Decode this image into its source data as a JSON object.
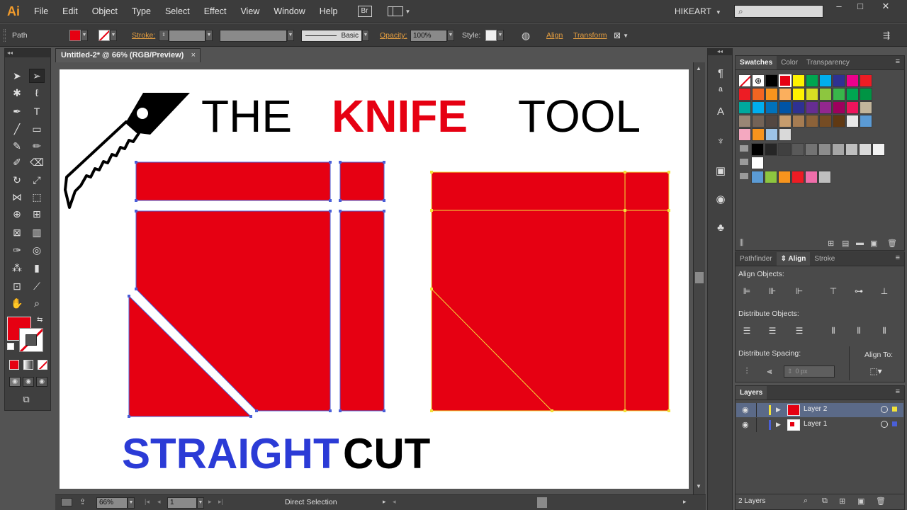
{
  "app": {
    "logo": "Ai",
    "menu": [
      "File",
      "Edit",
      "Object",
      "Type",
      "Select",
      "Effect",
      "View",
      "Window",
      "Help"
    ],
    "bridge_label": "Br",
    "workspace": "HIKEART",
    "window_controls": [
      "–",
      "□",
      "✕"
    ]
  },
  "control_bar": {
    "selection_type": "Path",
    "stroke_label": "Stroke:",
    "brush_label": "Basic",
    "opacity_label": "Opacity:",
    "opacity_value": "100%",
    "style_label": "Style:",
    "align_label": "Align",
    "transform_label": "Transform"
  },
  "document": {
    "tab_title": "Untitled-2* @ 66% (RGB/Preview)",
    "close": "×"
  },
  "artwork": {
    "title_words": [
      "THE",
      "KNIFE",
      "TOOL"
    ],
    "subtitle_words": [
      "STRAIGHT",
      "CUT"
    ],
    "colors": {
      "red": "#e60012",
      "blue": "#2b3bd6",
      "black": "#000000",
      "path_blue": "#4a5fd8",
      "path_yellow": "#f2e23a"
    }
  },
  "status_bar": {
    "zoom": "66%",
    "artboard_number": "1",
    "current_tool": "Direct Selection"
  },
  "swatches_panel": {
    "tabs": [
      "Swatches",
      "Color",
      "Transparency"
    ],
    "rows": [
      [
        "#ffffff",
        "#ffffff",
        "#000000",
        "#e60012",
        "#fff200",
        "#00a650",
        "#00aeef",
        "#2e3192",
        "#ec008c",
        "#ed1c24"
      ],
      [
        "#ed1c24",
        "#f26522",
        "#f7941d",
        "#fbaf5d",
        "#fff200",
        "#d7df23",
        "#8dc63f",
        "#39b54a",
        "#00a651",
        "#009444"
      ],
      [
        "#00a99d",
        "#00aeef",
        "#0072bc",
        "#0054a6",
        "#2e3192",
        "#662d91",
        "#92278f",
        "#9e005d",
        "#ed145b",
        "#c2b59b"
      ],
      [
        "#998675",
        "#736357",
        "#534741",
        "#c69c6d",
        "#a67c52",
        "#8c6239",
        "#754c24",
        "#603913",
        "#e8e8e8",
        "#5b9bd5"
      ],
      [
        "#f4a8c0",
        "#f7941d",
        "#9dc3e6",
        "#d9d9d9"
      ],
      [
        "#000000",
        "#262626",
        "#404040",
        "#595959",
        "#737373",
        "#8c8c8c",
        "#a6a6a6",
        "#bfbfbf",
        "#d9d9d9",
        "#f2f2f2"
      ],
      [
        "#ffffff"
      ],
      [
        "#5b9bd5",
        "#8dc63f",
        "#f7941d",
        "#ed1c24",
        "#f06eaa",
        "#bfbfbf"
      ]
    ]
  },
  "align_panel": {
    "tabs": [
      "Pathfinder",
      "Align",
      "Stroke"
    ],
    "align_objects": "Align Objects:",
    "distribute_objects": "Distribute Objects:",
    "distribute_spacing": "Distribute Spacing:",
    "align_to": "Align To:",
    "spacing_value": "0 px"
  },
  "layers_panel": {
    "tab": "Layers",
    "layers": [
      {
        "name": "Layer 2",
        "color": "#f2e23a"
      },
      {
        "name": "Layer 1",
        "color": "#4a5fd8"
      }
    ],
    "count": "2 Layers"
  }
}
